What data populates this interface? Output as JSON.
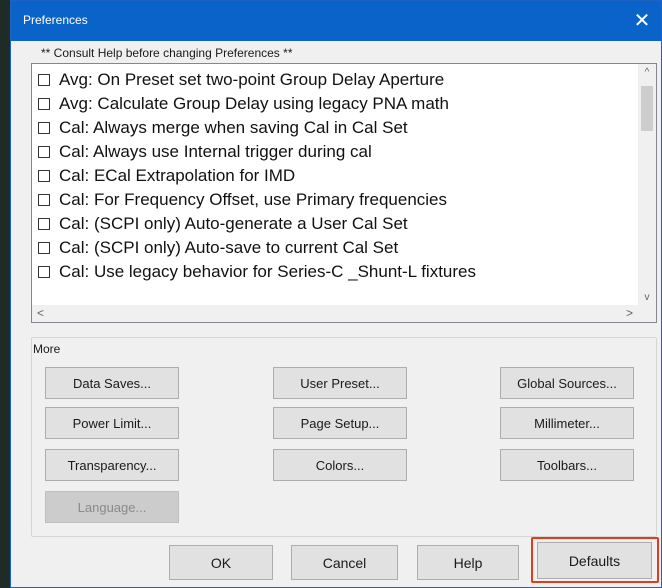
{
  "window": {
    "title": "Preferences",
    "close_glyph": "✕"
  },
  "consult_text": "** Consult Help before changing Preferences **",
  "preferences": [
    {
      "label": "Avg: On Preset set two-point Group Delay Aperture",
      "checked": false
    },
    {
      "label": "Avg: Calculate Group Delay using legacy PNA math",
      "checked": false
    },
    {
      "label": "Cal:  Always merge when saving Cal in Cal Set",
      "checked": false
    },
    {
      "label": "Cal: Always use Internal trigger during cal",
      "checked": false
    },
    {
      "label": "Cal: ECal Extrapolation for IMD",
      "checked": false
    },
    {
      "label": "Cal: For Frequency Offset, use Primary frequencies",
      "checked": false
    },
    {
      "label": "Cal: (SCPI only) Auto-generate a User Cal Set",
      "checked": false
    },
    {
      "label": "Cal: (SCPI only) Auto-save to current Cal Set",
      "checked": false
    },
    {
      "label": "Cal: Use legacy behavior for Series-C _Shunt-L fixtures",
      "checked": false
    }
  ],
  "scroll": {
    "up": "^",
    "down": "v",
    "left": "<",
    "right": ">"
  },
  "more": {
    "label": "More",
    "buttons": {
      "data_saves": "Data Saves...",
      "user_preset": "User Preset...",
      "global_sources": "Global Sources...",
      "power_limit": "Power Limit...",
      "page_setup": "Page Setup...",
      "millimeter": "Millimeter...",
      "transparency": "Transparency...",
      "colors": "Colors...",
      "toolbars": "Toolbars...",
      "language": "Language..."
    }
  },
  "footer": {
    "ok": "OK",
    "cancel": "Cancel",
    "help": "Help",
    "defaults": "Defaults"
  },
  "colors": {
    "titlebar": "#0a63c8",
    "highlight": "#e23b1f"
  }
}
